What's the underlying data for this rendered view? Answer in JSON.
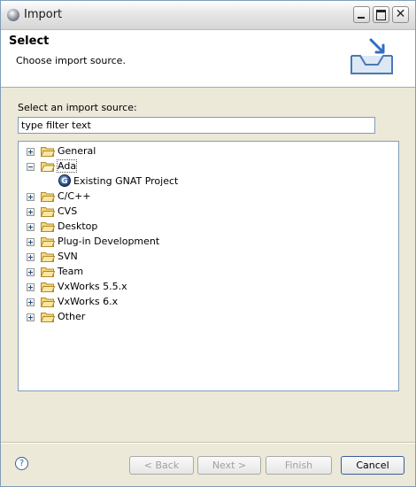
{
  "window": {
    "title": "Import"
  },
  "header": {
    "title": "Select",
    "description": "Choose import source."
  },
  "source": {
    "label": "Select an import source:",
    "filter_value": "type filter text"
  },
  "tree": {
    "items": [
      {
        "label": "General",
        "expanded": false
      },
      {
        "label": "Ada",
        "expanded": true,
        "selected": true,
        "children": [
          {
            "label": "Existing GNAT Project",
            "icon": "gnat-icon"
          }
        ]
      },
      {
        "label": "C/C++",
        "expanded": false
      },
      {
        "label": "CVS",
        "expanded": false
      },
      {
        "label": "Desktop",
        "expanded": false
      },
      {
        "label": "Plug-in Development",
        "expanded": false
      },
      {
        "label": "SVN",
        "expanded": false
      },
      {
        "label": "Team",
        "expanded": false
      },
      {
        "label": "VxWorks 5.5.x",
        "expanded": false
      },
      {
        "label": "VxWorks 6.x",
        "expanded": false
      },
      {
        "label": "Other",
        "expanded": false
      }
    ]
  },
  "buttons": {
    "back": "< Back",
    "next": "Next >",
    "finish": "Finish",
    "cancel": "Cancel"
  },
  "colors": {
    "accent": "#3a5d9c",
    "folder": "#f0c050"
  }
}
